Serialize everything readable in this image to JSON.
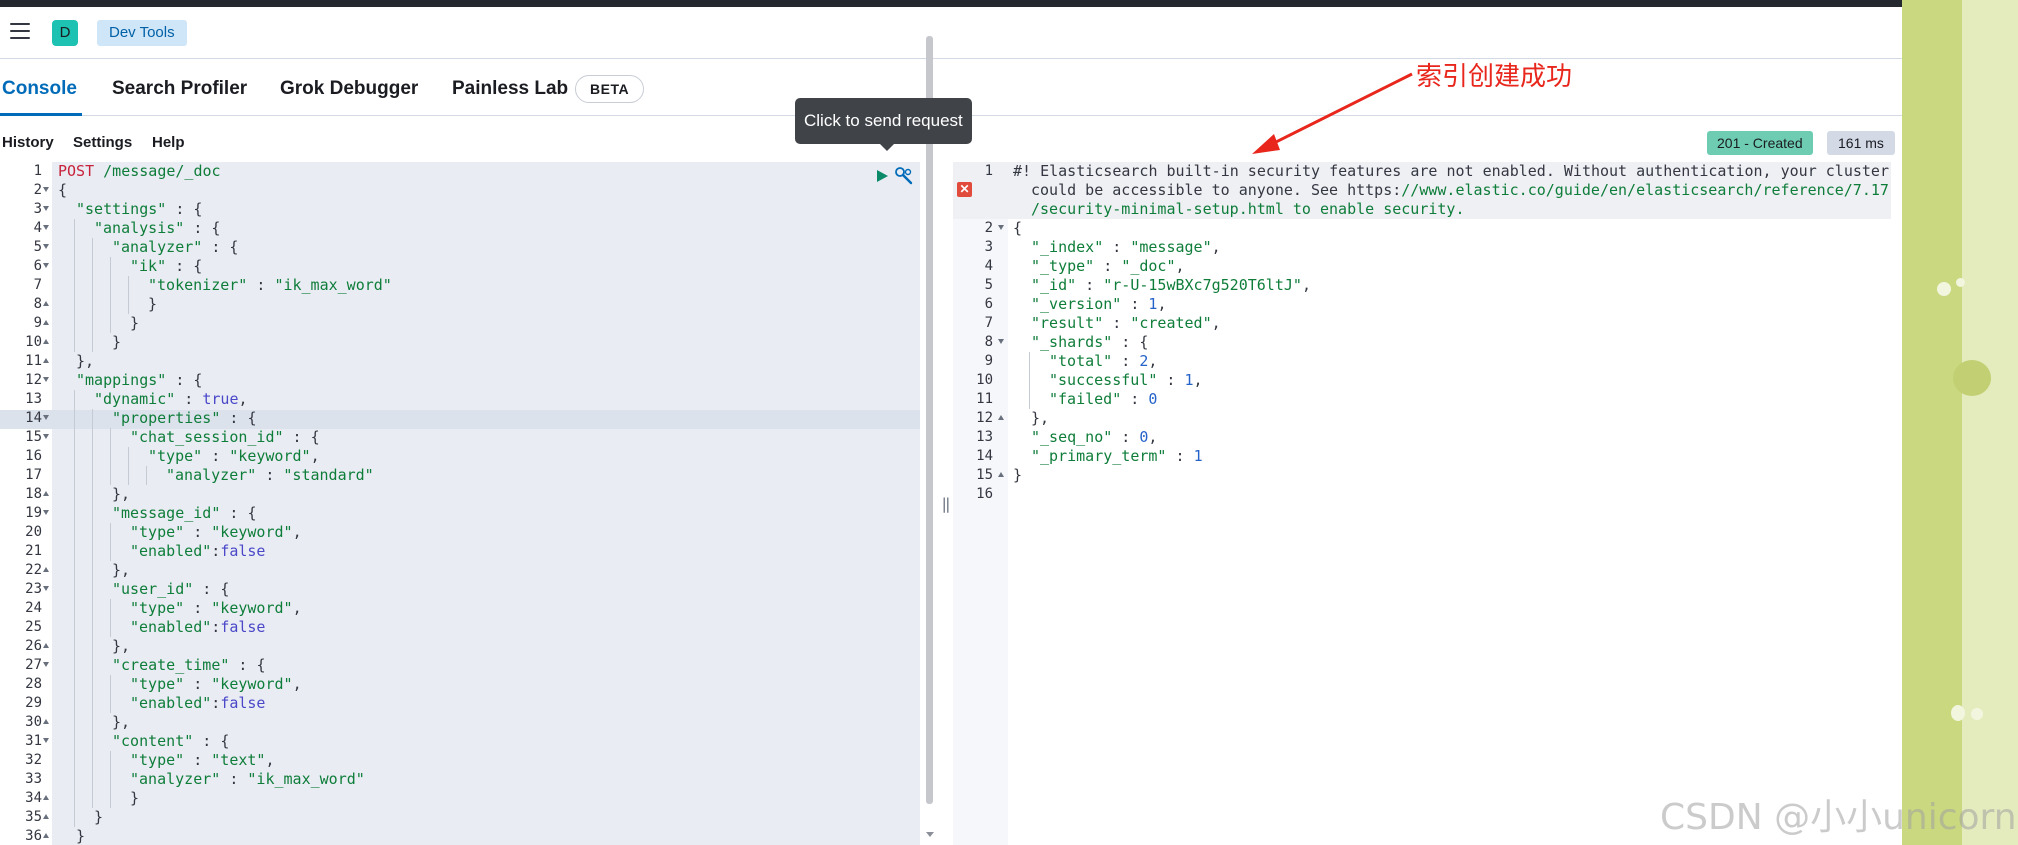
{
  "header": {
    "space_initial": "D",
    "breadcrumb": "Dev Tools"
  },
  "tabs": [
    {
      "label": "Console",
      "active": true
    },
    {
      "label": "Search Profiler",
      "active": false
    },
    {
      "label": "Grok Debugger",
      "active": false
    },
    {
      "label": "Painless Lab",
      "active": false
    }
  ],
  "beta_badge": "BETA",
  "subnav": {
    "history": "History",
    "settings": "Settings",
    "help": "Help"
  },
  "response": {
    "status": "201 - Created",
    "time": "161 ms"
  },
  "tooltip": "Click to send request",
  "annotation": "索引创建成功",
  "watermark": "CSDN @小小unicorn",
  "request_lines": [
    {
      "n": "1",
      "fold": "",
      "indent": 0,
      "t": [
        [
          "tok-method",
          "POST"
        ],
        [
          "tok-url",
          " /message/_doc"
        ]
      ]
    },
    {
      "n": "2",
      "fold": "open",
      "indent": 0,
      "t": [
        [
          "",
          "{"
        ]
      ]
    },
    {
      "n": "3",
      "fold": "open",
      "indent": 1,
      "t": [
        [
          "tok-key",
          "\"settings\""
        ],
        [
          "",
          " : {"
        ]
      ]
    },
    {
      "n": "4",
      "fold": "open",
      "indent": 2,
      "t": [
        [
          "tok-key",
          "\"analysis\""
        ],
        [
          "",
          " : {"
        ]
      ]
    },
    {
      "n": "5",
      "fold": "open",
      "indent": 3,
      "t": [
        [
          "tok-key",
          "\"analyzer\""
        ],
        [
          "",
          " : {"
        ]
      ]
    },
    {
      "n": "6",
      "fold": "open",
      "indent": 4,
      "t": [
        [
          "tok-key",
          "\"ik\""
        ],
        [
          "",
          " : {"
        ]
      ]
    },
    {
      "n": "7",
      "fold": "",
      "indent": 5,
      "t": [
        [
          "tok-key",
          "\"tokenizer\""
        ],
        [
          "",
          " : "
        ],
        [
          "tok-str",
          "\"ik_max_word\""
        ]
      ]
    },
    {
      "n": "8",
      "fold": "close",
      "indent": 5,
      "t": [
        [
          "",
          "}"
        ]
      ]
    },
    {
      "n": "9",
      "fold": "close",
      "indent": 4,
      "t": [
        [
          "",
          "}"
        ]
      ]
    },
    {
      "n": "10",
      "fold": "close",
      "indent": 3,
      "t": [
        [
          "",
          "}"
        ]
      ]
    },
    {
      "n": "11",
      "fold": "close",
      "indent": 1,
      "t": [
        [
          "",
          "},"
        ]
      ]
    },
    {
      "n": "12",
      "fold": "open",
      "indent": 1,
      "t": [
        [
          "tok-key",
          "\"mappings\""
        ],
        [
          "",
          " : {"
        ]
      ]
    },
    {
      "n": "13",
      "fold": "",
      "indent": 2,
      "t": [
        [
          "tok-key",
          "\"dynamic\""
        ],
        [
          "",
          " : "
        ],
        [
          "tok-kw",
          "true"
        ],
        [
          "",
          ","
        ]
      ]
    },
    {
      "n": "14",
      "fold": "open",
      "indent": 3,
      "t": [
        [
          "tok-key",
          "\"properties\""
        ],
        [
          "",
          " : {"
        ]
      ]
    },
    {
      "n": "15",
      "fold": "open",
      "indent": 4,
      "t": [
        [
          "tok-key",
          "\"chat_session_id\""
        ],
        [
          "",
          " : {"
        ]
      ]
    },
    {
      "n": "16",
      "fold": "",
      "indent": 5,
      "t": [
        [
          "tok-key",
          "\"type\""
        ],
        [
          "",
          " : "
        ],
        [
          "tok-str",
          "\"keyword\""
        ],
        [
          "",
          ","
        ]
      ]
    },
    {
      "n": "17",
      "fold": "",
      "indent": 6,
      "t": [
        [
          "tok-key",
          "\"analyzer\""
        ],
        [
          "",
          " : "
        ],
        [
          "tok-str",
          "\"standard\""
        ]
      ]
    },
    {
      "n": "18",
      "fold": "close",
      "indent": 3,
      "t": [
        [
          "",
          "},"
        ]
      ]
    },
    {
      "n": "19",
      "fold": "open",
      "indent": 3,
      "t": [
        [
          "tok-key",
          "\"message_id\""
        ],
        [
          "",
          " : {"
        ]
      ]
    },
    {
      "n": "20",
      "fold": "",
      "indent": 4,
      "t": [
        [
          "tok-key",
          "\"type\""
        ],
        [
          "",
          " : "
        ],
        [
          "tok-str",
          "\"keyword\""
        ],
        [
          "",
          ","
        ]
      ]
    },
    {
      "n": "21",
      "fold": "",
      "indent": 4,
      "t": [
        [
          "tok-key",
          "\"enabled\""
        ],
        [
          "",
          ":"
        ],
        [
          "tok-kw",
          "false"
        ]
      ]
    },
    {
      "n": "22",
      "fold": "close",
      "indent": 3,
      "t": [
        [
          "",
          "},"
        ]
      ]
    },
    {
      "n": "23",
      "fold": "open",
      "indent": 3,
      "t": [
        [
          "tok-key",
          "\"user_id\""
        ],
        [
          "",
          " : {"
        ]
      ]
    },
    {
      "n": "24",
      "fold": "",
      "indent": 4,
      "t": [
        [
          "tok-key",
          "\"type\""
        ],
        [
          "",
          " : "
        ],
        [
          "tok-str",
          "\"keyword\""
        ],
        [
          "",
          ","
        ]
      ]
    },
    {
      "n": "25",
      "fold": "",
      "indent": 4,
      "t": [
        [
          "tok-key",
          "\"enabled\""
        ],
        [
          "",
          ":"
        ],
        [
          "tok-kw",
          "false"
        ]
      ]
    },
    {
      "n": "26",
      "fold": "close",
      "indent": 3,
      "t": [
        [
          "",
          "},"
        ]
      ]
    },
    {
      "n": "27",
      "fold": "open",
      "indent": 3,
      "t": [
        [
          "tok-key",
          "\"create_time\""
        ],
        [
          "",
          " : {"
        ]
      ]
    },
    {
      "n": "28",
      "fold": "",
      "indent": 4,
      "t": [
        [
          "tok-key",
          "\"type\""
        ],
        [
          "",
          " : "
        ],
        [
          "tok-str",
          "\"keyword\""
        ],
        [
          "",
          ","
        ]
      ]
    },
    {
      "n": "29",
      "fold": "",
      "indent": 4,
      "t": [
        [
          "tok-key",
          "\"enabled\""
        ],
        [
          "",
          ":"
        ],
        [
          "tok-kw",
          "false"
        ]
      ]
    },
    {
      "n": "30",
      "fold": "close",
      "indent": 3,
      "t": [
        [
          "",
          "},"
        ]
      ]
    },
    {
      "n": "31",
      "fold": "open",
      "indent": 3,
      "t": [
        [
          "tok-key",
          "\"content\""
        ],
        [
          "",
          " : {"
        ]
      ]
    },
    {
      "n": "32",
      "fold": "",
      "indent": 4,
      "t": [
        [
          "tok-key",
          "\"type\""
        ],
        [
          "",
          " : "
        ],
        [
          "tok-str",
          "\"text\""
        ],
        [
          "",
          ","
        ]
      ]
    },
    {
      "n": "33",
      "fold": "",
      "indent": 4,
      "t": [
        [
          "tok-key",
          "\"analyzer\""
        ],
        [
          "",
          " : "
        ],
        [
          "tok-str",
          "\"ik_max_word\""
        ]
      ]
    },
    {
      "n": "34",
      "fold": "close",
      "indent": 4,
      "t": [
        [
          "",
          "}"
        ]
      ]
    },
    {
      "n": "35",
      "fold": "close",
      "indent": 2,
      "t": [
        [
          "",
          "}"
        ]
      ]
    },
    {
      "n": "36",
      "fold": "close",
      "indent": 1,
      "t": [
        [
          "",
          "}"
        ]
      ]
    }
  ],
  "response_lines": [
    {
      "n": "1",
      "fold": "",
      "indent": 0,
      "t": [
        [
          "tok-comment",
          "#! Elasticsearch built-in security features are not enabled. Without authentication, your cluster"
        ]
      ]
    },
    {
      "n": "",
      "fold": "",
      "indent": 1,
      "t": [
        [
          "tok-comment",
          "could be accessible to anyone. See https:"
        ],
        [
          "tok-link",
          "//www.elastic.co/guide/en/elasticsearch/reference/7.17"
        ]
      ]
    },
    {
      "n": "",
      "fold": "",
      "indent": 1,
      "t": [
        [
          "tok-link",
          "/security-minimal-setup.html to enable security."
        ]
      ]
    },
    {
      "n": "2",
      "fold": "open",
      "indent": 0,
      "t": [
        [
          "",
          "{"
        ]
      ]
    },
    {
      "n": "3",
      "fold": "",
      "indent": 1,
      "t": [
        [
          "tok-key",
          "\"_index\""
        ],
        [
          "",
          " : "
        ],
        [
          "tok-str",
          "\"message\""
        ],
        [
          "",
          ","
        ]
      ]
    },
    {
      "n": "4",
      "fold": "",
      "indent": 1,
      "t": [
        [
          "tok-key",
          "\"_type\""
        ],
        [
          "",
          " : "
        ],
        [
          "tok-str",
          "\"_doc\""
        ],
        [
          "",
          ","
        ]
      ]
    },
    {
      "n": "5",
      "fold": "",
      "indent": 1,
      "t": [
        [
          "tok-key",
          "\"_id\""
        ],
        [
          "",
          " : "
        ],
        [
          "tok-str",
          "\"r-U-15wBXc7g520T6ltJ\""
        ],
        [
          "",
          ","
        ]
      ]
    },
    {
      "n": "6",
      "fold": "",
      "indent": 1,
      "t": [
        [
          "tok-key",
          "\"_version\""
        ],
        [
          "",
          " : "
        ],
        [
          "tok-num",
          "1"
        ],
        [
          "",
          ","
        ]
      ]
    },
    {
      "n": "7",
      "fold": "",
      "indent": 1,
      "t": [
        [
          "tok-key",
          "\"result\""
        ],
        [
          "",
          " : "
        ],
        [
          "tok-str",
          "\"created\""
        ],
        [
          "",
          ","
        ]
      ]
    },
    {
      "n": "8",
      "fold": "open",
      "indent": 1,
      "t": [
        [
          "tok-key",
          "\"_shards\""
        ],
        [
          "",
          " : {"
        ]
      ]
    },
    {
      "n": "9",
      "fold": "",
      "indent": 2,
      "t": [
        [
          "tok-key",
          "\"total\""
        ],
        [
          "",
          " : "
        ],
        [
          "tok-num",
          "2"
        ],
        [
          "",
          ","
        ]
      ]
    },
    {
      "n": "10",
      "fold": "",
      "indent": 2,
      "t": [
        [
          "tok-key",
          "\"successful\""
        ],
        [
          "",
          " : "
        ],
        [
          "tok-num",
          "1"
        ],
        [
          "",
          ","
        ]
      ]
    },
    {
      "n": "11",
      "fold": "",
      "indent": 2,
      "t": [
        [
          "tok-key",
          "\"failed\""
        ],
        [
          "",
          " : "
        ],
        [
          "tok-num",
          "0"
        ]
      ]
    },
    {
      "n": "12",
      "fold": "close",
      "indent": 1,
      "t": [
        [
          "",
          "},"
        ]
      ]
    },
    {
      "n": "13",
      "fold": "",
      "indent": 1,
      "t": [
        [
          "tok-key",
          "\"_seq_no\""
        ],
        [
          "",
          " : "
        ],
        [
          "tok-num",
          "0"
        ],
        [
          "",
          ","
        ]
      ]
    },
    {
      "n": "14",
      "fold": "",
      "indent": 1,
      "t": [
        [
          "tok-key",
          "\"_primary_term\""
        ],
        [
          "",
          " : "
        ],
        [
          "tok-num",
          "1"
        ]
      ]
    },
    {
      "n": "15",
      "fold": "close",
      "indent": 0,
      "t": [
        [
          "",
          "}"
        ]
      ]
    },
    {
      "n": "16",
      "fold": "",
      "indent": 0,
      "t": []
    }
  ]
}
